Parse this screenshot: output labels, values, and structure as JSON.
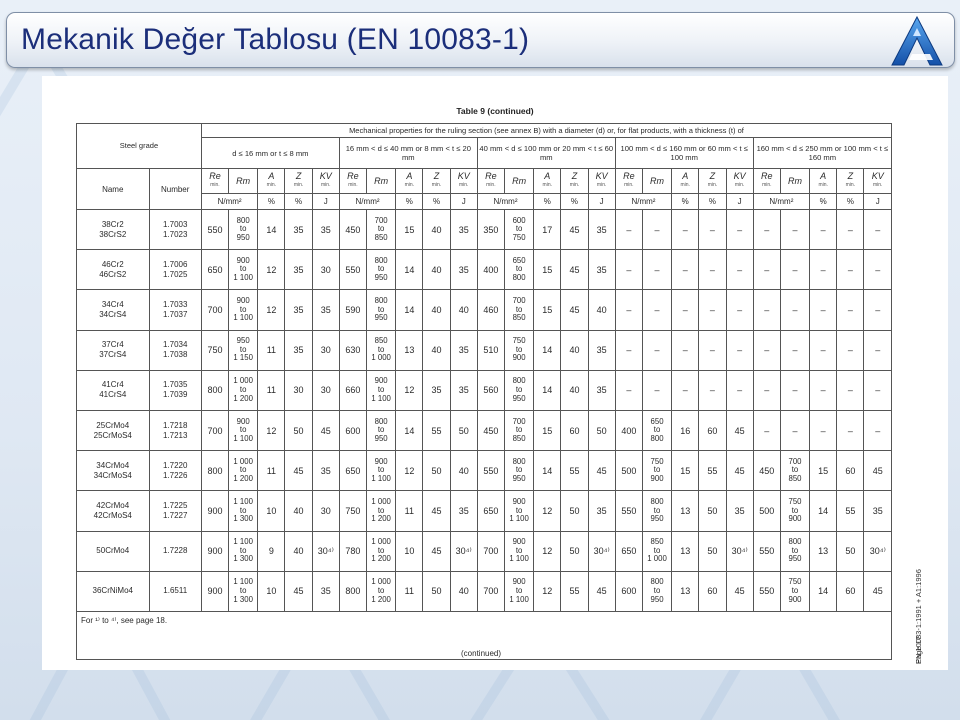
{
  "header": {
    "title": "Mekanik Değer Tablosu (EN 10083-1)"
  },
  "colors": {
    "title_text": "#1b2e7a",
    "logo_blue": "#1e73c8"
  },
  "document": {
    "caption": "Table 9 (continued)",
    "col_steel_grade": "Steel grade",
    "col_name": "Name",
    "col_number": "Number",
    "mech_props": "Mechanical properties for the ruling section (see annex B) with a diameter (d) or, for flat products, with a thickness (t) of",
    "ranges": [
      "d ≤ 16 mm  or  t ≤ 8 mm",
      "16 mm < d ≤ 40 mm  or 8 mm < t ≤ 20 mm",
      "40 mm < d ≤ 100 mm  or 20 mm < t ≤ 60 mm",
      "100 mm < d ≤ 160 mm  or 60 mm < t ≤ 100 mm",
      "160 mm < d ≤ 250 mm  or 100 mm < t ≤ 160 mm"
    ],
    "prop_symbols": [
      "Re",
      "Rm",
      "A",
      "Z",
      "KV"
    ],
    "prop_subs": [
      "min.",
      "",
      "min.",
      "min.",
      "min."
    ],
    "units": [
      "N/mm²",
      "%",
      "%",
      "J"
    ],
    "rows": [
      {
        "name": [
          "38Cr2",
          "38CrS2"
        ],
        "number": [
          "1.7003",
          "1.7023"
        ],
        "cells": [
          "550",
          [
            "800",
            "to",
            "950"
          ],
          "14",
          "35",
          "35",
          "450",
          [
            "700",
            "to",
            "850"
          ],
          "15",
          "40",
          "35",
          "350",
          [
            "600",
            "to",
            "750"
          ],
          "17",
          "45",
          "35",
          "–",
          "–",
          "–",
          "–",
          "–",
          "–",
          "–",
          "–",
          "–",
          "–"
        ]
      },
      {
        "name": [
          "46Cr2",
          "46CrS2"
        ],
        "number": [
          "1.7006",
          "1.7025"
        ],
        "cells": [
          "650",
          [
            "900",
            "to",
            "1 100"
          ],
          "12",
          "35",
          "30",
          "550",
          [
            "800",
            "to",
            "950"
          ],
          "14",
          "40",
          "35",
          "400",
          [
            "650",
            "to",
            "800"
          ],
          "15",
          "45",
          "35",
          "–",
          "–",
          "–",
          "–",
          "–",
          "–",
          "–",
          "–",
          "–",
          "–"
        ]
      },
      {
        "name": [
          "34Cr4",
          "34CrS4"
        ],
        "number": [
          "1.7033",
          "1.7037"
        ],
        "cells": [
          "700",
          [
            "900",
            "to",
            "1 100"
          ],
          "12",
          "35",
          "35",
          "590",
          [
            "800",
            "to",
            "950"
          ],
          "14",
          "40",
          "40",
          "460",
          [
            "700",
            "to",
            "850"
          ],
          "15",
          "45",
          "40",
          "–",
          "–",
          "–",
          "–",
          "–",
          "–",
          "–",
          "–",
          "–",
          "–"
        ]
      },
      {
        "name": [
          "37Cr4",
          "37CrS4"
        ],
        "number": [
          "1.7034",
          "1.7038"
        ],
        "cells": [
          "750",
          [
            "950",
            "to",
            "1 150"
          ],
          "11",
          "35",
          "30",
          "630",
          [
            "850",
            "to",
            "1 000"
          ],
          "13",
          "40",
          "35",
          "510",
          [
            "750",
            "to",
            "900"
          ],
          "14",
          "40",
          "35",
          "–",
          "–",
          "–",
          "–",
          "–",
          "–",
          "–",
          "–",
          "–",
          "–"
        ]
      },
      {
        "name": [
          "41Cr4",
          "41CrS4"
        ],
        "number": [
          "1.7035",
          "1.7039"
        ],
        "cells": [
          "800",
          [
            "1 000",
            "to",
            "1 200"
          ],
          "11",
          "30",
          "30",
          "660",
          [
            "900",
            "to",
            "1 100"
          ],
          "12",
          "35",
          "35",
          "560",
          [
            "800",
            "to",
            "950"
          ],
          "14",
          "40",
          "35",
          "–",
          "–",
          "–",
          "–",
          "–",
          "–",
          "–",
          "–",
          "–",
          "–"
        ]
      },
      {
        "name": [
          "25CrMo4",
          "25CrMoS4"
        ],
        "number": [
          "1.7218",
          "1.7213"
        ],
        "cells": [
          "700",
          [
            "900",
            "to",
            "1 100"
          ],
          "12",
          "50",
          "45",
          "600",
          [
            "800",
            "to",
            "950"
          ],
          "14",
          "55",
          "50",
          "450",
          [
            "700",
            "to",
            "850"
          ],
          "15",
          "60",
          "50",
          "400",
          [
            "650",
            "to",
            "800"
          ],
          "16",
          "60",
          "45",
          "–",
          "–",
          "–",
          "–",
          "–"
        ]
      },
      {
        "name": [
          "34CrMo4",
          "34CrMoS4"
        ],
        "number": [
          "1.7220",
          "1.7226"
        ],
        "cells": [
          "800",
          [
            "1 000",
            "to",
            "1 200"
          ],
          "11",
          "45",
          "35",
          "650",
          [
            "900",
            "to",
            "1 100"
          ],
          "12",
          "50",
          "40",
          "550",
          [
            "800",
            "to",
            "950"
          ],
          "14",
          "55",
          "45",
          "500",
          [
            "750",
            "to",
            "900"
          ],
          "15",
          "55",
          "45",
          "450",
          [
            "700",
            "to",
            "850"
          ],
          "15",
          "60",
          "45"
        ]
      },
      {
        "name": [
          "42CrMo4",
          "42CrMoS4"
        ],
        "number": [
          "1.7225",
          "1.7227"
        ],
        "cells": [
          "900",
          [
            "1 100",
            "to",
            "1 300"
          ],
          "10",
          "40",
          "30",
          "750",
          [
            "1 000",
            "to",
            "1 200"
          ],
          "11",
          "45",
          "35",
          "650",
          [
            "900",
            "to",
            "1 100"
          ],
          "12",
          "50",
          "35",
          "550",
          [
            "800",
            "to",
            "950"
          ],
          "13",
          "50",
          "35",
          "500",
          [
            "750",
            "to",
            "900"
          ],
          "14",
          "55",
          "35"
        ]
      },
      {
        "name": [
          "50CrMo4"
        ],
        "number": [
          "1.7228"
        ],
        "cells": [
          "900",
          [
            "1 100",
            "to",
            "1 300"
          ],
          "9",
          "40",
          "30⁴⁾",
          "780",
          [
            "1 000",
            "to",
            "1 200"
          ],
          "10",
          "45",
          "30⁴⁾",
          "700",
          [
            "900",
            "to",
            "1 100"
          ],
          "12",
          "50",
          "30⁴⁾",
          "650",
          [
            "850",
            "to",
            "1 000"
          ],
          "13",
          "50",
          "30⁴⁾",
          "550",
          [
            "800",
            "to",
            "950"
          ],
          "13",
          "50",
          "30⁴⁾"
        ]
      },
      {
        "name": [
          "36CrNiMo4"
        ],
        "number": [
          "1.6511"
        ],
        "cells": [
          "900",
          [
            "1 100",
            "to",
            "1 300"
          ],
          "10",
          "45",
          "35",
          "800",
          [
            "1 000",
            "to",
            "1 200"
          ],
          "11",
          "50",
          "40",
          "700",
          [
            "900",
            "to",
            "1 100"
          ],
          "12",
          "55",
          "45",
          "600",
          [
            "800",
            "to",
            "950"
          ],
          "13",
          "60",
          "45",
          "550",
          [
            "750",
            "to",
            "900"
          ],
          "14",
          "60",
          "45"
        ]
      }
    ],
    "footnote": "For ¹⁾ to ⁴⁾, see page 18.",
    "continued": "(continued)",
    "side_note_1": "EN 10083-1:1991 + A1:1996",
    "side_note_2": "Page 17"
  }
}
